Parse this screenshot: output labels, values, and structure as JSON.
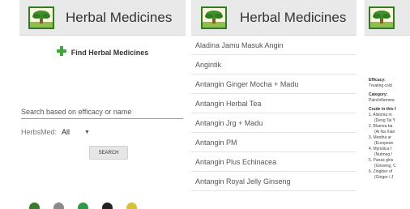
{
  "app_title": "Herbal Medicines",
  "search_screen": {
    "find_button_label": "Find Herbal Medicines",
    "search_placeholder": "Search based on efficacy or name",
    "herbsmed_label": "HerbsMed:",
    "herbsmed_value": "All",
    "search_button_label": "SEARCH"
  },
  "list_screen": {
    "items": [
      "Aladina Jamu Masuk Angin",
      "Angintik",
      "Antangin Ginger Mocha + Madu",
      "Antangin Herbal Tea",
      "Antangin Jrg + Madu",
      "Antangin PM",
      "Antangin Plus Echinacea",
      "Antangin Royal Jelly Ginseng"
    ]
  },
  "detail_screen": {
    "efficacy_label": "Efficacy:",
    "efficacy_value": "Treating cold",
    "category_label": "Category:",
    "category_value": "Pain/inflamma",
    "crude_label": "Crude in this f",
    "crude_items": [
      {
        "line1": "1. Alstonia m",
        "line2": "(Deng Tai Y"
      },
      {
        "line1": "2. Blumea ba",
        "line2": "(Ai Na Xian"
      },
      {
        "line1": "3. Mentha ar",
        "line2": "(European"
      },
      {
        "line1": "4. Myristica f",
        "line2": "(Nutmeg /"
      },
      {
        "line1": "5. Panax gins",
        "line2": "(Ginseng, C"
      },
      {
        "line1": "6. Zingiber of",
        "line2": "(Ginger / J"
      }
    ]
  },
  "colors": {
    "header_bg": "#e9e9e9",
    "plus_icon": "#3aa83a",
    "logo_border": "#2f7a24",
    "bottom_icons": [
      "#3b7a2c",
      "#8a8a8a",
      "#2f9a4a",
      "#222222",
      "#d6c23a"
    ]
  }
}
